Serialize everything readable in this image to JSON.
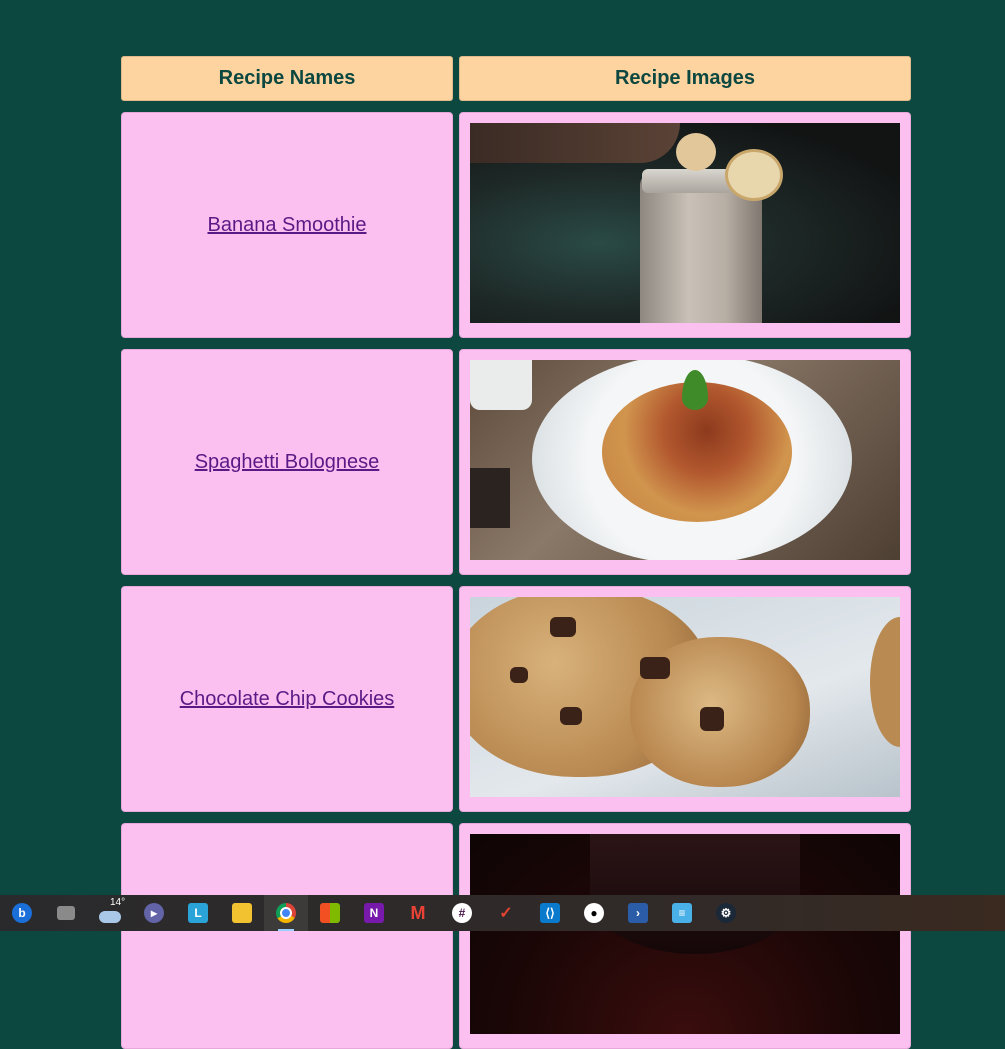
{
  "table": {
    "headers": {
      "names": "Recipe Names",
      "images": "Recipe Images"
    },
    "recipes": [
      {
        "name": "Banana Smoothie",
        "image": "banana-smoothie-photo"
      },
      {
        "name": "Spaghetti Bolognese",
        "image": "spaghetti-bolognese-photo"
      },
      {
        "name": "Chocolate Chip Cookies",
        "image": "chocolate-chip-cookies-photo"
      },
      {
        "name": "",
        "image": "drink-photo"
      }
    ]
  },
  "taskbar": {
    "weather_temp": "14°",
    "icons": [
      "bing-icon",
      "task-view-icon",
      "weather-icon",
      "teams-chat-icon",
      "l-app-icon",
      "file-explorer-icon",
      "chrome-icon",
      "microsoft-store-icon",
      "onenote-icon",
      "gmail-icon",
      "slack-icon",
      "todoist-icon",
      "vscode-icon",
      "github-icon",
      "powershell-icon",
      "notepad-icon",
      "steam-icon"
    ]
  },
  "colors": {
    "background": "#0c4840",
    "header": "#fdd3a0",
    "cell": "#fcc0f0",
    "link": "#5a1a86"
  }
}
